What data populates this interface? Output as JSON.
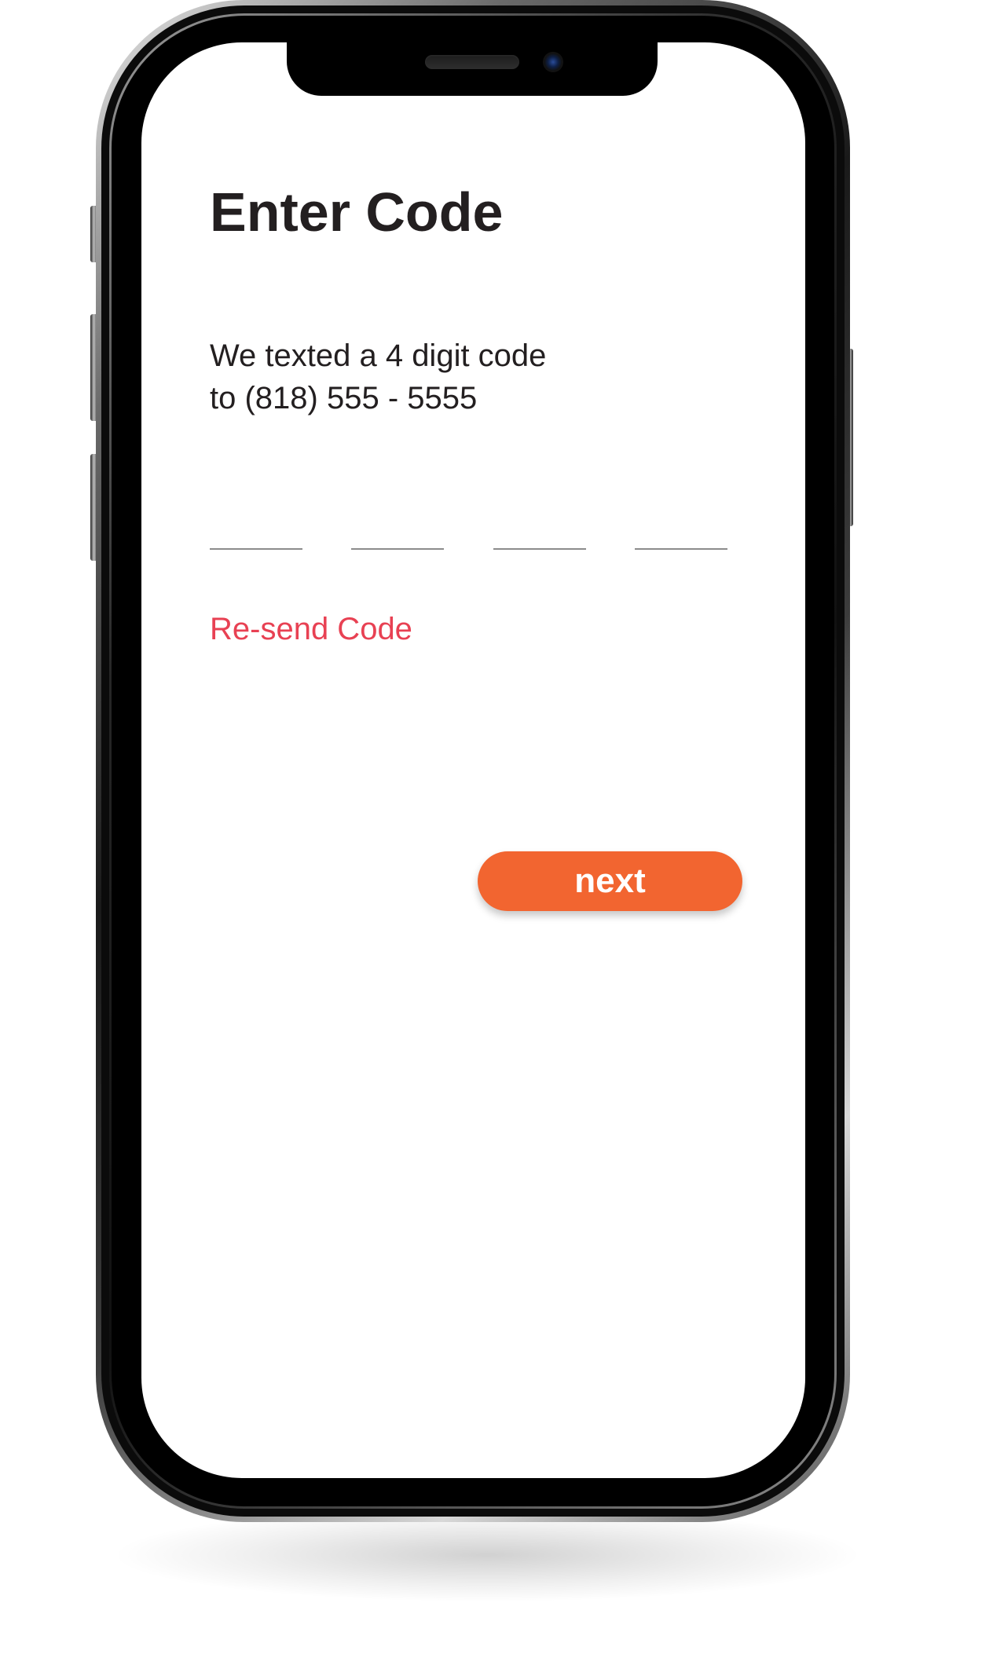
{
  "screen": {
    "title": "Enter Code",
    "message_line1": "We texted a 4 digit code",
    "message_line2": "to (818) 555 - 5555",
    "code_inputs": [
      {
        "value": ""
      },
      {
        "value": ""
      },
      {
        "value": ""
      },
      {
        "value": ""
      }
    ],
    "resend_label": "Re-send Code",
    "next_label": "next"
  },
  "colors": {
    "text": "#231f20",
    "resend": "#e84153",
    "next_button": "#f26530",
    "code_underline": "#8c8c8c"
  },
  "icons": [
    "earpiece-speaker-icon",
    "front-camera-icon"
  ]
}
